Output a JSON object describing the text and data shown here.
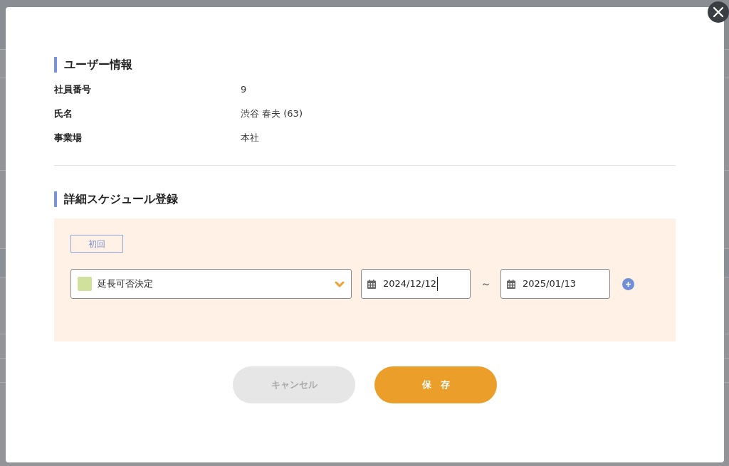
{
  "user_info": {
    "heading": "ユーザー情報",
    "fields": [
      {
        "label": "社員番号",
        "value": "9"
      },
      {
        "label": "氏名",
        "value": "渋谷 春夫 (63)"
      },
      {
        "label": "事業場",
        "value": "本社"
      }
    ]
  },
  "schedule": {
    "heading": "詳細スケジュール登録",
    "badge": "初回",
    "entries": [
      {
        "type": {
          "value": "延長可否決定",
          "color": "#cfe29b"
        },
        "start": {
          "value": "2024/12/12",
          "focused": true
        },
        "separator": "～",
        "end": {
          "value": "2025/01/13",
          "focused": false
        }
      }
    ]
  },
  "buttons": [
    {
      "label": "キャンセル",
      "kind": "secondary",
      "disabled": true
    },
    {
      "label": "保　存",
      "kind": "primary",
      "disabled": false
    }
  ]
}
